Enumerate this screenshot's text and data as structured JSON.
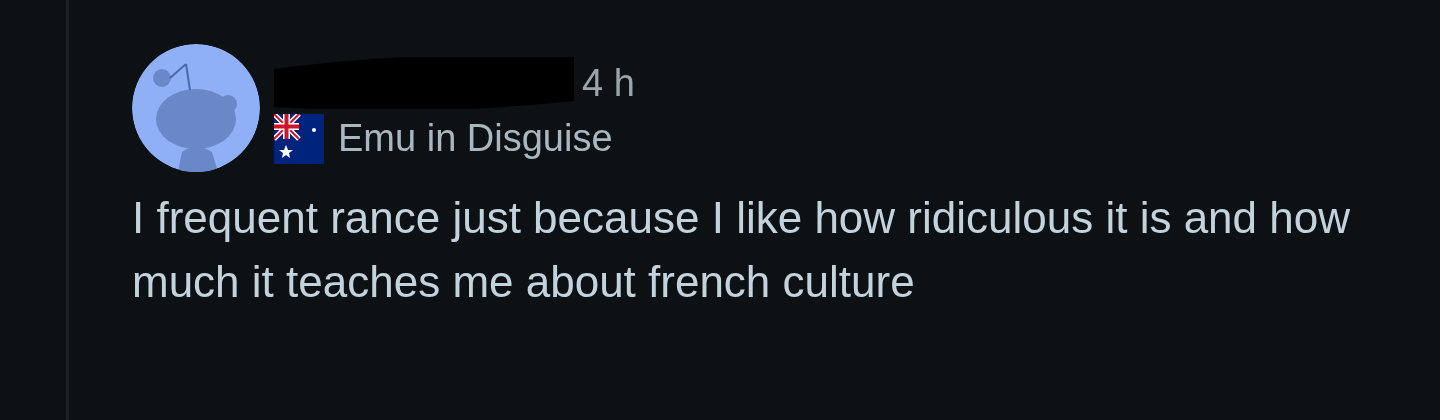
{
  "comment": {
    "time": "4 h",
    "flair": "Emu in Disguise",
    "body": "I frequent rance just because I like how ridiculous it is and how much it teaches me about french culture"
  }
}
